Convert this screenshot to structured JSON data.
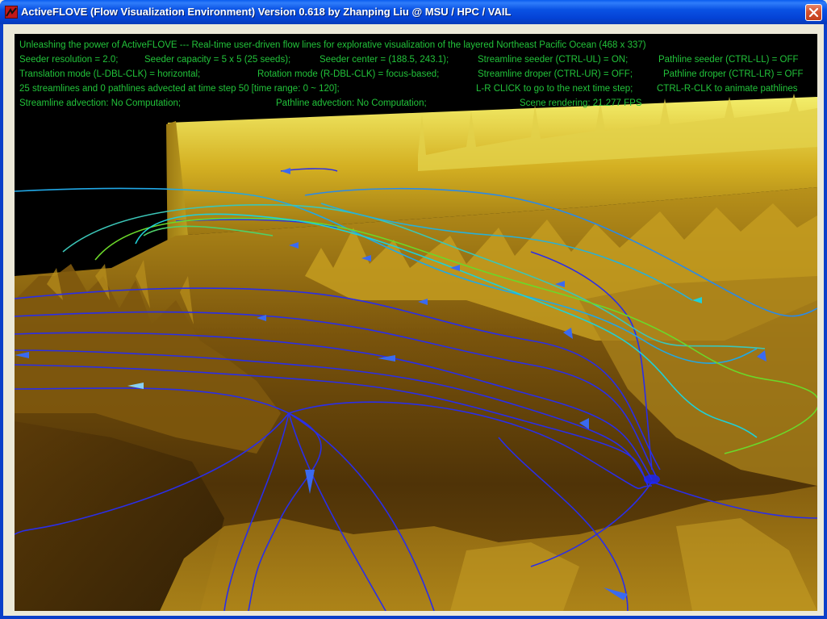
{
  "window": {
    "title": "ActiveFLOVE (Flow Visualization Environment) Version 0.618 by Zhanping Liu @ MSU / HPC / VAIL",
    "close_icon": "close-icon",
    "app_icon": "app-logo-icon"
  },
  "hud": {
    "line1": "Unleashing the power of ActiveFLOVE --- Real-time user-driven flow lines for explorative visualization of the layered Northeast Pacific Ocean (468 x 337)",
    "line2": {
      "resolution": "Seeder resolution = 2.0;",
      "capacity": "Seeder capacity = 5 x 5 (25 seeds);",
      "center": "Seeder center = (188.5, 243.1);",
      "streamline_seeder": "Streamline seeder (CTRL-UL) =  ON;",
      "pathline_seeder": "Pathline seeder (CTRL-LL) = OFF"
    },
    "line3": {
      "translation": "Translation mode (L-DBL-CLK) = horizontal;",
      "rotation": "Rotation mode (R-DBL-CLK) = focus-based;",
      "streamline_droper": "Streamline droper (CTRL-UR) = OFF;",
      "pathline_droper": "Pathline droper (CTRL-LR) = OFF"
    },
    "line4": {
      "advected": "25 streamlines and  0 pathlines advected at time step  50 [time range: 0 ~ 120];",
      "lr_click": "L-R CLICK to go to the next time step;",
      "ctrl_r_clk": "CTRL-R-CLK to animate pathlines"
    },
    "line5": {
      "streamline_advection": "Streamline advection:   No Computation;",
      "pathline_advection": "Pathline advection:   No Computation;",
      "scene_rendering": "Scene rendering:    21.277 FPS"
    }
  },
  "colors": {
    "hud_text": "#22c33a",
    "terrain_dark": "#3a2506",
    "terrain_mid": "#8a5f0e",
    "terrain_light": "#c9a21c",
    "streamline_blue": "#2a2ee8",
    "streamline_cyan": "#1fd0d8",
    "streamline_green": "#6bd82a"
  }
}
